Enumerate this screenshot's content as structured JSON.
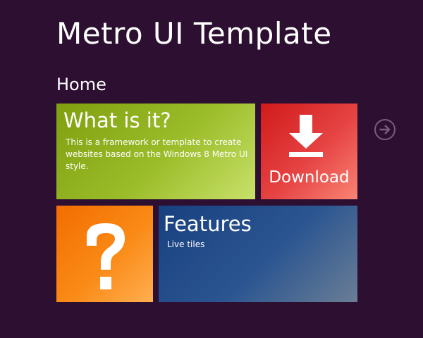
{
  "header": {
    "title": "Metro UI Template",
    "section": "Home"
  },
  "tiles": {
    "whatis": {
      "title": "What is it?",
      "description": "This is a framework or template to create websites based on the Windows 8 Metro UI style.",
      "color": "#9cbd2a"
    },
    "download": {
      "label": "Download",
      "icon": "download-arrow-icon",
      "color": "#e64444"
    },
    "help": {
      "icon": "question-mark-icon",
      "color": "#fa8a16"
    },
    "features": {
      "title": "Features",
      "description": "Live tiles",
      "color": "#2b5591"
    }
  },
  "navigation": {
    "next_icon": "arrow-right-circle-icon"
  },
  "colors": {
    "background": "#2d0f32"
  }
}
